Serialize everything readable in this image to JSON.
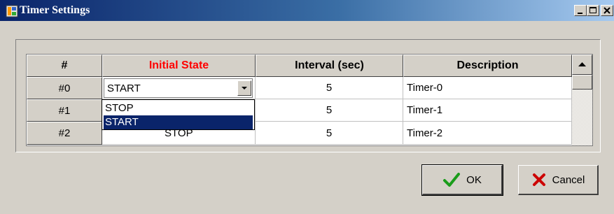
{
  "window": {
    "title": "Timer Settings"
  },
  "grid": {
    "columns": [
      "#",
      "Initial State",
      "Interval (sec)",
      "Description"
    ],
    "rows": [
      {
        "index": "#0",
        "state": "START",
        "interval": "5",
        "description": "Timer-0"
      },
      {
        "index": "#1",
        "state": "STOP",
        "interval": "5",
        "description": "Timer-1"
      },
      {
        "index": "#2",
        "state": "STOP",
        "interval": "5",
        "description": "Timer-2"
      }
    ],
    "dropdown_options": [
      "STOP",
      "START"
    ],
    "dropdown_selected": "START"
  },
  "buttons": {
    "ok": "OK",
    "cancel": "Cancel"
  },
  "colors": {
    "title_start": "#0a246a",
    "title_end": "#a6caf0",
    "header_accent": "#ff0000",
    "selection": "#0a246a",
    "ok_check": "#1a9c1a",
    "cancel_x": "#cc0000"
  },
  "icons": [
    "app-timer-icon",
    "minimize-icon",
    "maximize-icon",
    "close-icon",
    "chevron-down-icon",
    "scroll-up-icon",
    "checkmark-icon",
    "x-mark-icon"
  ]
}
